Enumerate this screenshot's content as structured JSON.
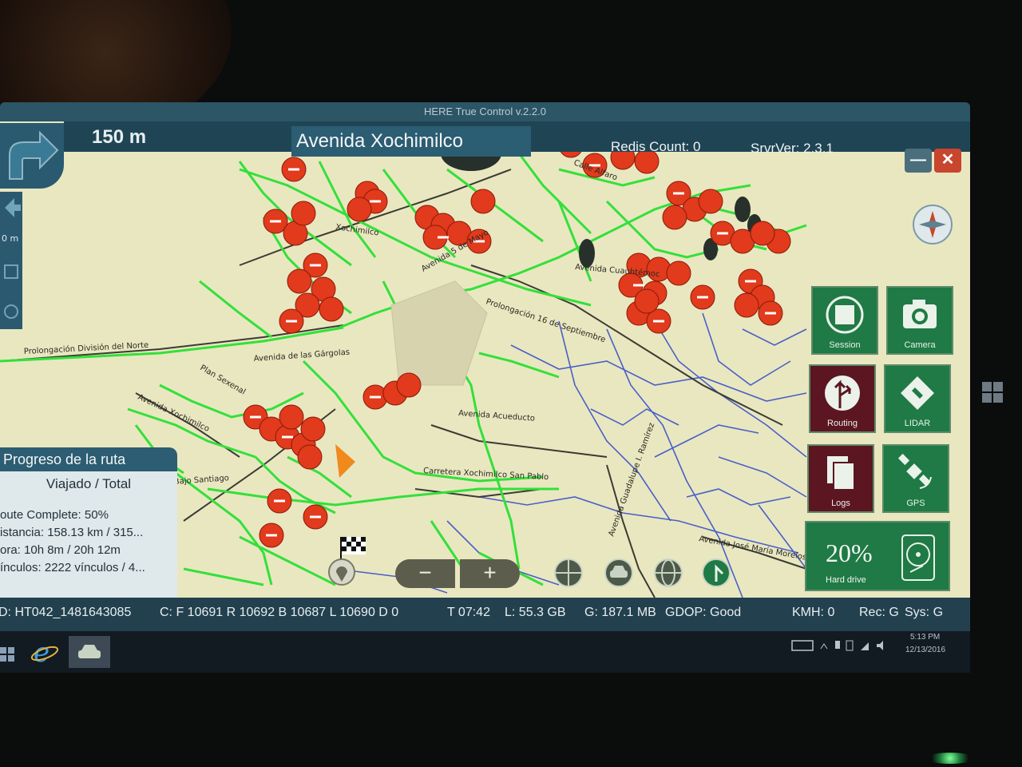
{
  "app": {
    "title": "HERE True Control v.2.2.0"
  },
  "navigation": {
    "distance": "150 m",
    "street_name": "Avenida Xochimilco",
    "side_label": "0 m"
  },
  "header": {
    "redis_count": "Redis Count: 0",
    "server_version": "SrvrVer: 2.3.1"
  },
  "window_controls": {
    "minimize": "—",
    "close": "✕"
  },
  "map": {
    "street_labels": [
      "Prolongación División del Norte",
      "Avenida de las Gárgolas",
      "Plan Sexenal",
      "Avenida Xochimilco",
      "Prolongación 16 de Septiembre",
      "Avenida Acueducto",
      "Carretera Xochimilco San Pablo",
      "Avenida Guadalupe I. Ramírez",
      "Avenida José María Morelos",
      "Xochimilco",
      "Avenida Cuauhtémoc",
      "Calle Alfaro",
      "Avenida 5 de Mayo",
      "Bajo Santiago"
    ]
  },
  "tiles": [
    {
      "label": "Session",
      "icon": "session-icon"
    },
    {
      "label": "Camera",
      "icon": "camera-icon"
    },
    {
      "label": "Routing",
      "icon": "routing-icon"
    },
    {
      "label": "LIDAR",
      "icon": "lidar-icon"
    },
    {
      "label": "Logs",
      "icon": "logs-icon"
    },
    {
      "label": "GPS",
      "icon": "gps-icon"
    }
  ],
  "hard_drive": {
    "percent": "20%",
    "label": "Hard drive"
  },
  "route_progress": {
    "title": "Progreso de la ruta",
    "subtitle": "Viajado / Total",
    "route_complete": "oute Complete: 50%",
    "distance": "istancia: 158.13 km / 315...",
    "time": "ora: 10h 8m / 20h 12m",
    "links": "ínculos: 2222 vínculos / 4..."
  },
  "map_controls": {
    "zoom_out": "−",
    "zoom_in": "+"
  },
  "status_bar": {
    "drive_id": "D: HT042_1481643085",
    "counts": "C: F 10691 R 10692 B 10687 L 10690 D 0",
    "time": "T 07:42",
    "local": "L:  55.3 GB",
    "gps_mem": "G: 187.1 MB",
    "gdop": "GDOP: Good",
    "kmh": "KMH: 0",
    "rec": "Rec: G",
    "sys": "Sys: G"
  },
  "taskbar": {
    "time": "5:13 PM",
    "date": "12/13/2016"
  },
  "colors": {
    "traveled": "#33e03a",
    "untraveled": "#4a5fc8",
    "poi": "#e13a1c",
    "tile_green": "#1f7a45",
    "tile_maroon": "#5b1621"
  }
}
